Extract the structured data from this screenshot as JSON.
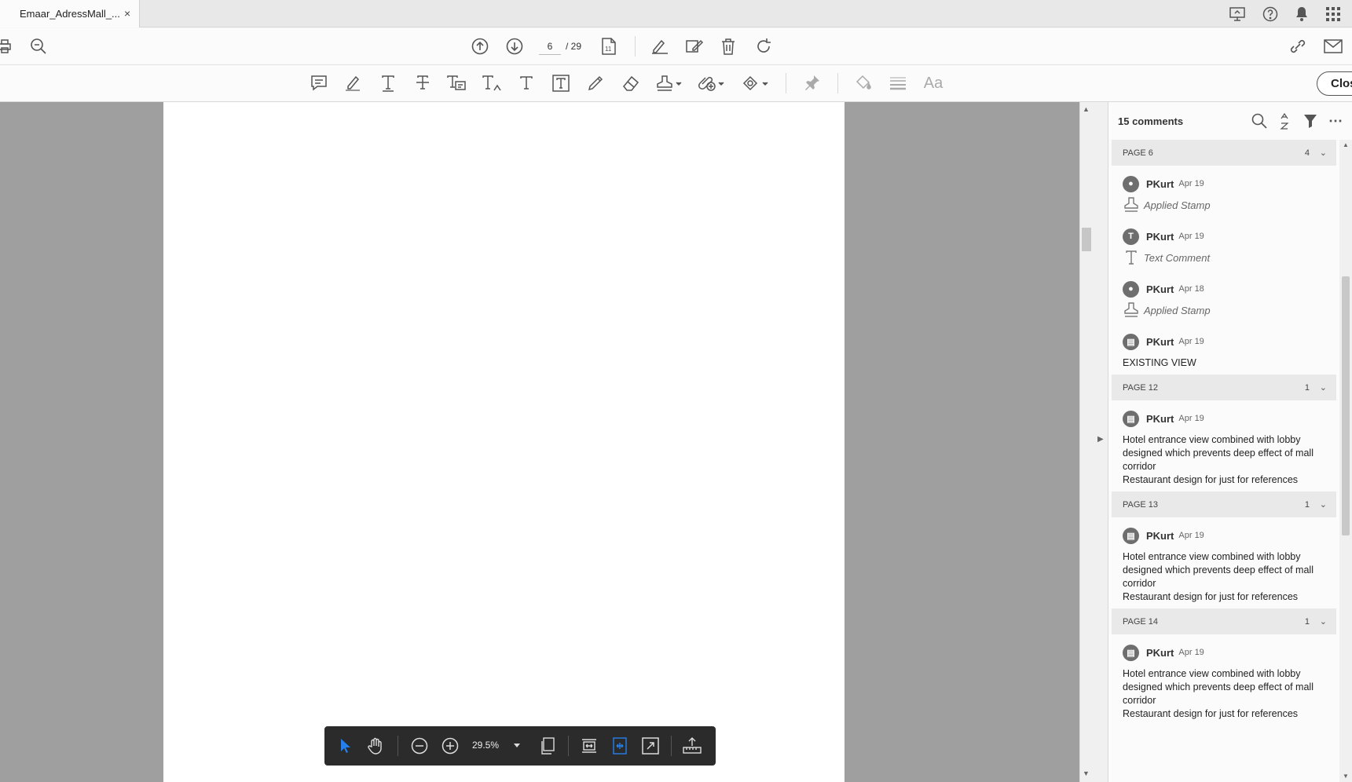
{
  "tab": {
    "title": "Emaar_AdressMall_...",
    "close": "×"
  },
  "toolbar": {
    "page_current": "6",
    "page_total": "/ 29",
    "close_label": "Clos"
  },
  "comments": {
    "count_label": "15 comments",
    "groups": [
      {
        "page": "PAGE 6",
        "count": "4",
        "items": [
          {
            "author": "PKurt",
            "date": "Apr 19",
            "kind": "stamp",
            "type_label": "Applied Stamp",
            "text": ""
          },
          {
            "author": "PKurt",
            "date": "Apr 19",
            "kind": "text",
            "type_label": "Text Comment",
            "text": ""
          },
          {
            "author": "PKurt",
            "date": "Apr 18",
            "kind": "stamp",
            "type_label": "Applied Stamp",
            "text": ""
          },
          {
            "author": "PKurt",
            "date": "Apr 19",
            "kind": "note",
            "type_label": "",
            "text": "EXISTING VIEW"
          }
        ]
      },
      {
        "page": "PAGE 12",
        "count": "1",
        "items": [
          {
            "author": "PKurt",
            "date": "Apr 19",
            "kind": "note",
            "type_label": "",
            "text": "Hotel entrance view combined with lobby designed which prevents deep effect of mall corridor\nRestaurant design for just for references"
          }
        ]
      },
      {
        "page": "PAGE 13",
        "count": "1",
        "items": [
          {
            "author": "PKurt",
            "date": "Apr 19",
            "kind": "note",
            "type_label": "",
            "text": "Hotel entrance view combined with lobby designed which prevents deep effect of mall corridor\nRestaurant design for just for references"
          }
        ]
      },
      {
        "page": "PAGE 14",
        "count": "1",
        "items": [
          {
            "author": "PKurt",
            "date": "Apr 19",
            "kind": "note",
            "type_label": "",
            "text": "Hotel entrance view combined with lobby designed which prevents deep effect of mall corridor\nRestaurant design for just for references"
          }
        ]
      }
    ]
  },
  "floating_toolbar": {
    "zoom": "29.5%"
  },
  "colors": {
    "accent": "#2680eb",
    "viewer_bg": "#9f9f9f",
    "floatbar_bg": "#2b2b2b"
  },
  "icons": [
    "print-icon",
    "zoom-search-icon",
    "page-up-icon",
    "page-down-icon",
    "page-layout-icon",
    "sign-icon",
    "edit-pdf-icon",
    "delete-icon",
    "rotate-icon",
    "share-link-icon",
    "email-icon",
    "comment-icon",
    "highlight-icon",
    "text-icon",
    "strikethrough-icon",
    "replace-text-icon",
    "insert-text-icon",
    "text-box-icon",
    "text-field-icon",
    "pencil-icon",
    "eraser-icon",
    "stamp-icon",
    "attach-icon",
    "shapes-icon",
    "pin-icon",
    "fill-icon",
    "line-weight-icon",
    "font-icon",
    "select-cursor-icon",
    "hand-icon",
    "zoom-out-icon",
    "zoom-in-icon",
    "single-page-icon",
    "fit-width-icon",
    "fit-page-icon",
    "fullscreen-icon",
    "export-icon"
  ]
}
